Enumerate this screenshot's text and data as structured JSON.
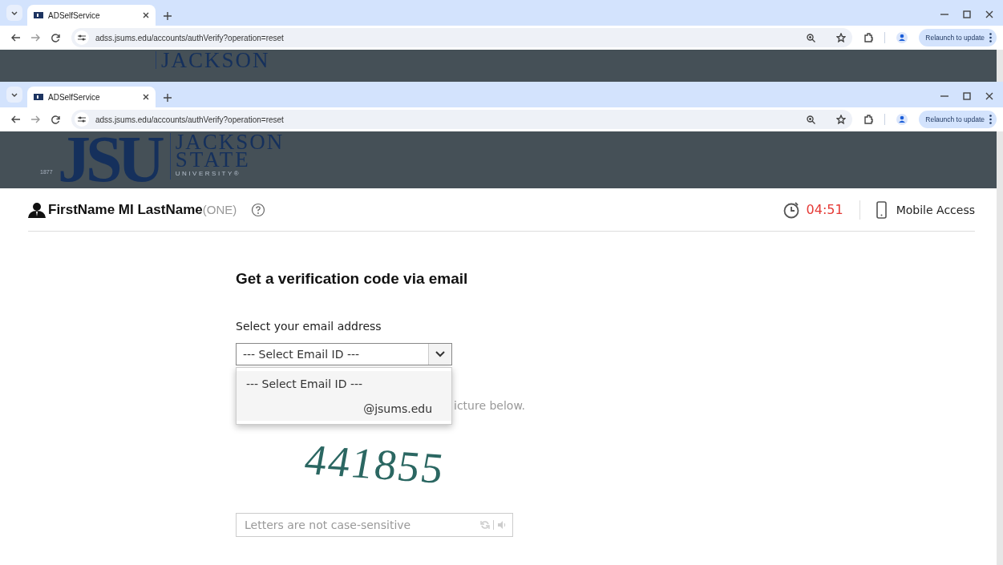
{
  "windows": [
    {
      "tab_title": "ADSelfService",
      "url": "adss.jsums.edu/accounts/authVerify?operation=reset",
      "update_button": "Relaunch to update",
      "banner": {
        "logo_lines": [
          "JACKSON"
        ]
      }
    },
    {
      "tab_title": "ADSelfService",
      "url": "adss.jsums.edu/accounts/authVerify?operation=reset",
      "update_button": "Relaunch to update",
      "banner": {
        "logo_mark": "JSU",
        "logo_year": "1877",
        "logo_lines": [
          "JACKSON",
          "STATE",
          "UNIVERSITY®"
        ]
      }
    }
  ],
  "page": {
    "user": {
      "name": "FirstName MI LastName",
      "domain": "(ONE)"
    },
    "timer": "04:51",
    "mobile_access": "Mobile Access",
    "heading": "Get a verification code via email",
    "email_label": "Select your email address",
    "email_select": {
      "value": "--- Select Email ID ---",
      "expanded": true,
      "options": [
        "--- Select Email ID ---",
        "@jsums.edu"
      ]
    },
    "captcha_hint": "icture below.",
    "captcha": "441855",
    "captcha_input": {
      "placeholder": "Letters are not case-sensitive"
    }
  }
}
